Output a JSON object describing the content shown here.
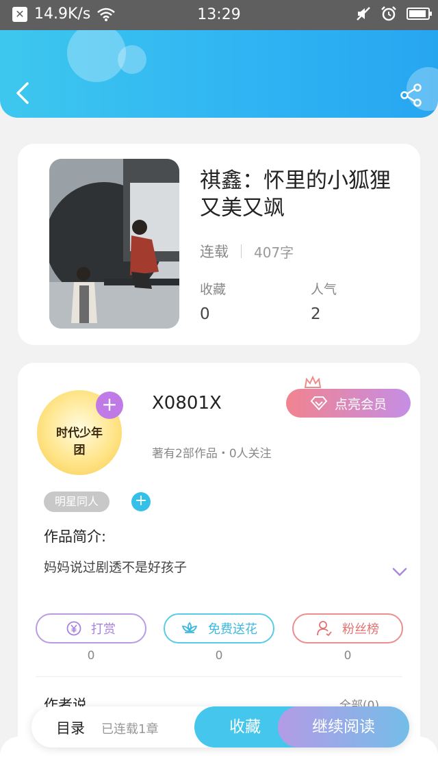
{
  "status_bar": {
    "speed": "14.9K/s",
    "time": "13:29",
    "left_icons": [
      "close-box-icon",
      "wifi-icon"
    ],
    "right_icons": [
      "mute-icon",
      "alarm-icon",
      "battery-icon"
    ]
  },
  "header": {
    "back_icon": "chevron-left-icon",
    "share_icon": "share-icon",
    "colors": {
      "from": "#3ec7ee",
      "to": "#27a6f0"
    }
  },
  "book": {
    "title": "祺鑫：怀里的小狐狸又美又飒",
    "status": "连载",
    "word_count": "407字",
    "stats": [
      {
        "label": "收藏",
        "value": "0"
      },
      {
        "label": "人气",
        "value": "2"
      }
    ]
  },
  "author": {
    "avatar_text": "时代少年团",
    "name": "X0801X",
    "meta": "著有2部作品・0人关注",
    "vip_label": "点亮会员",
    "tag": "明星同人",
    "intro_label": "作品简介:",
    "intro_text": "妈妈说过剧透不是好孩子"
  },
  "actions": [
    {
      "label": "打赏",
      "count": "0",
      "icon": "yen-icon"
    },
    {
      "label": "免费送花",
      "count": "0",
      "icon": "flower-icon"
    },
    {
      "label": "粉丝榜",
      "count": "0",
      "icon": "fans-icon"
    }
  ],
  "author_says": {
    "label": "作者说",
    "all_label": "全部(0)"
  },
  "bottom": {
    "toc_label": "目录",
    "toc_sub": "已连载1章",
    "favorite_label": "收藏",
    "read_label": "继续阅读"
  }
}
